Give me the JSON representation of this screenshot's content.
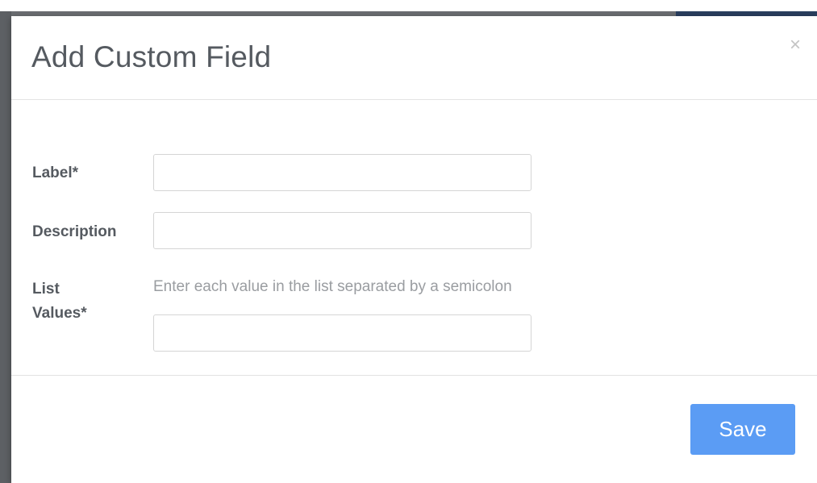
{
  "modal": {
    "title": "Add Custom Field",
    "close_glyph": "×"
  },
  "form": {
    "label": {
      "text": "Label*",
      "value": "",
      "placeholder": ""
    },
    "description": {
      "text": "Description",
      "value": "",
      "placeholder": ""
    },
    "list_values": {
      "text_line1": "List",
      "text_line2": "Values*",
      "hint": "Enter each value in the list separated by a semicolon",
      "value": "",
      "placeholder": ""
    }
  },
  "footer": {
    "save_label": "Save"
  },
  "colors": {
    "accent": "#5b9cf4",
    "title_text": "#555a60",
    "hint_text": "#9a9da1",
    "backdrop": "#6b6e72"
  }
}
